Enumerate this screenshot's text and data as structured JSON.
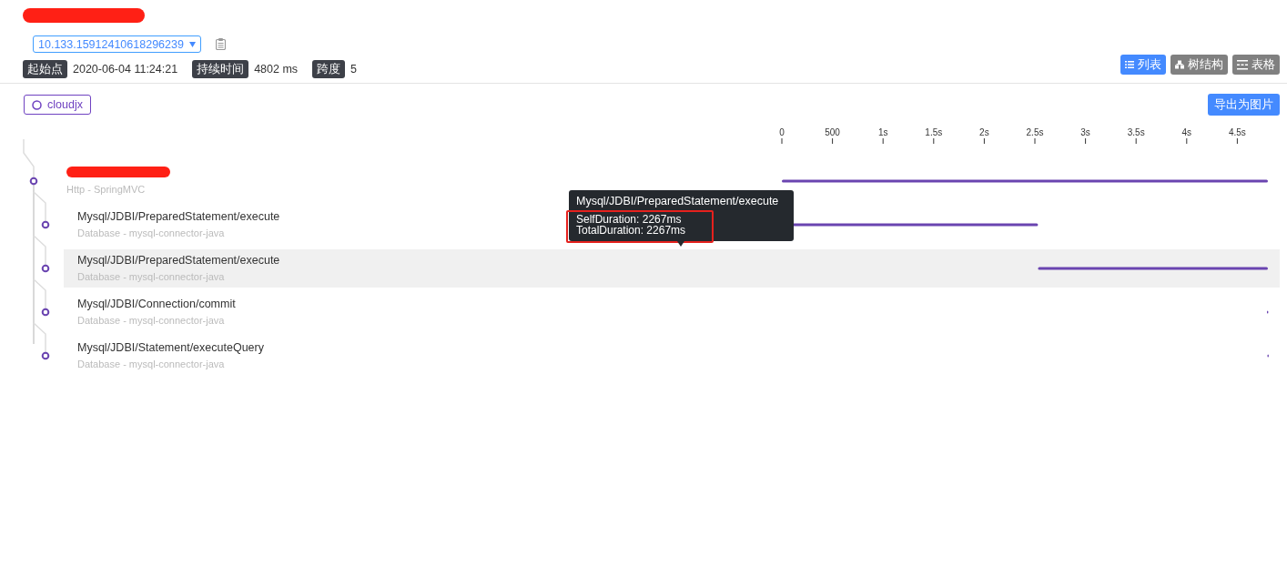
{
  "header": {
    "trace_id": "10.133.15912410618296239",
    "meta": [
      {
        "label": "起始点",
        "value": "2020-06-04 11:24:21"
      },
      {
        "label": "持续时间",
        "value": "4802 ms"
      },
      {
        "label": "跨度",
        "value": "5"
      }
    ],
    "views": [
      {
        "label": "列表",
        "kind": "list",
        "selected": true
      },
      {
        "label": "树结构",
        "kind": "tree",
        "selected": false
      },
      {
        "label": "表格",
        "kind": "table",
        "selected": false
      }
    ]
  },
  "services": [
    {
      "label": "cloudjx",
      "color": "#6f42c1"
    }
  ],
  "export_button": "导出为图片",
  "spans": [
    {
      "sub": "Http - SpringMVC",
      "highlighted": false,
      "children": [
        {
          "name": "Mysql/JDBI/PreparedStatement/execute",
          "sub": "Database - mysql-connector-java",
          "highlighted": false
        },
        {
          "name": "Mysql/JDBI/PreparedStatement/execute",
          "sub": "Database - mysql-connector-java",
          "highlighted": true
        },
        {
          "name": "Mysql/JDBI/Connection/commit",
          "sub": "Database - mysql-connector-java",
          "highlighted": false
        },
        {
          "name": "Mysql/JDBI/Statement/executeQuery",
          "sub": "Database - mysql-connector-java",
          "highlighted": false
        }
      ]
    }
  ],
  "timeline": {
    "ticks": [
      "0",
      "500",
      "1s",
      "1.5s",
      "2s",
      "2.5s",
      "3s",
      "3.5s",
      "4s",
      "4.5s"
    ]
  },
  "tooltip": {
    "title": "Mysql/JDBI/PreparedStatement/execute",
    "lines": [
      "SelfDuration: 2267ms",
      "TotalDuration: 2267ms"
    ]
  }
}
